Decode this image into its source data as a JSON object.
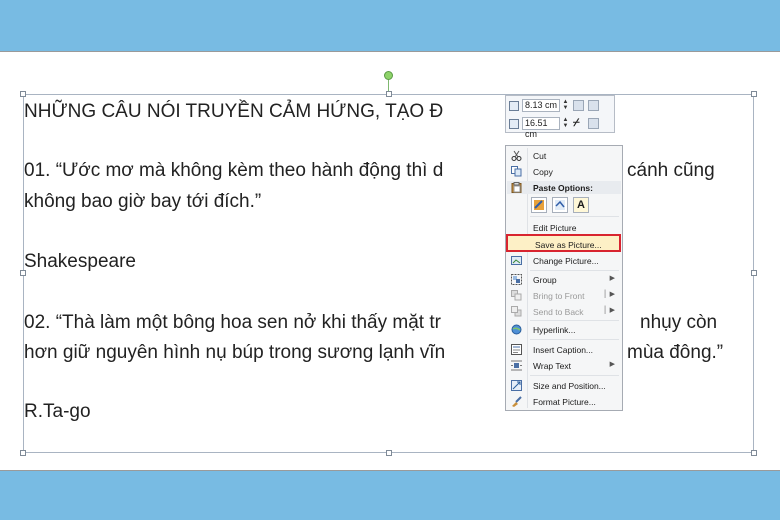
{
  "document": {
    "heading": "NHỮNG CÂU NÓI TRUYỀN CẢM HỨNG, TẠO Đ",
    "quote1_line1_a": "01. “Ước mơ mà không kèm theo hành động thì d",
    "quote1_line1_b": "cánh cũng",
    "quote1_line2": "không bao giờ bay tới đích.”",
    "author1": "Shakespeare",
    "quote2_line1_a": "02. “Thà làm một bông hoa sen nở khi thấy mặt tr",
    "quote2_line1_b": "nhụy còn",
    "quote2_line2_a": "hơn giữ nguyên hình nụ búp trong sương lạnh vĩn",
    "quote2_line2_b": "mùa đông.”",
    "author2": " R.Ta-go"
  },
  "size_toolbar": {
    "height_value": "8.13 cm",
    "width_value": "16.51 cm"
  },
  "context_menu": {
    "cut": "Cut",
    "copy": "Copy",
    "paste_options": "Paste Options:",
    "edit_picture": "Edit Picture",
    "save_as_picture": "Save as Picture...",
    "change_picture": "Change Picture...",
    "group": "Group",
    "bring_to_front": "Bring to Front",
    "send_to_back": "Send to Back",
    "hyperlink": "Hyperlink...",
    "insert_caption": "Insert Caption...",
    "wrap_text": "Wrap Text",
    "size_and_position": "Size and Position...",
    "format_picture": "Format Picture..."
  },
  "icons": {
    "cut": "scissors-icon",
    "copy": "copy-icon",
    "paste": "clipboard-icon",
    "group": "group-icon",
    "bring_front": "bring-to-front-icon",
    "send_back": "send-to-back-icon",
    "hyperlink": "globe-link-icon",
    "caption": "caption-icon",
    "wrap": "wrap-text-icon",
    "size": "size-position-icon",
    "format": "format-picture-icon"
  },
  "colors": {
    "background": "#78bbe3",
    "highlight_border": "#d8242f"
  }
}
